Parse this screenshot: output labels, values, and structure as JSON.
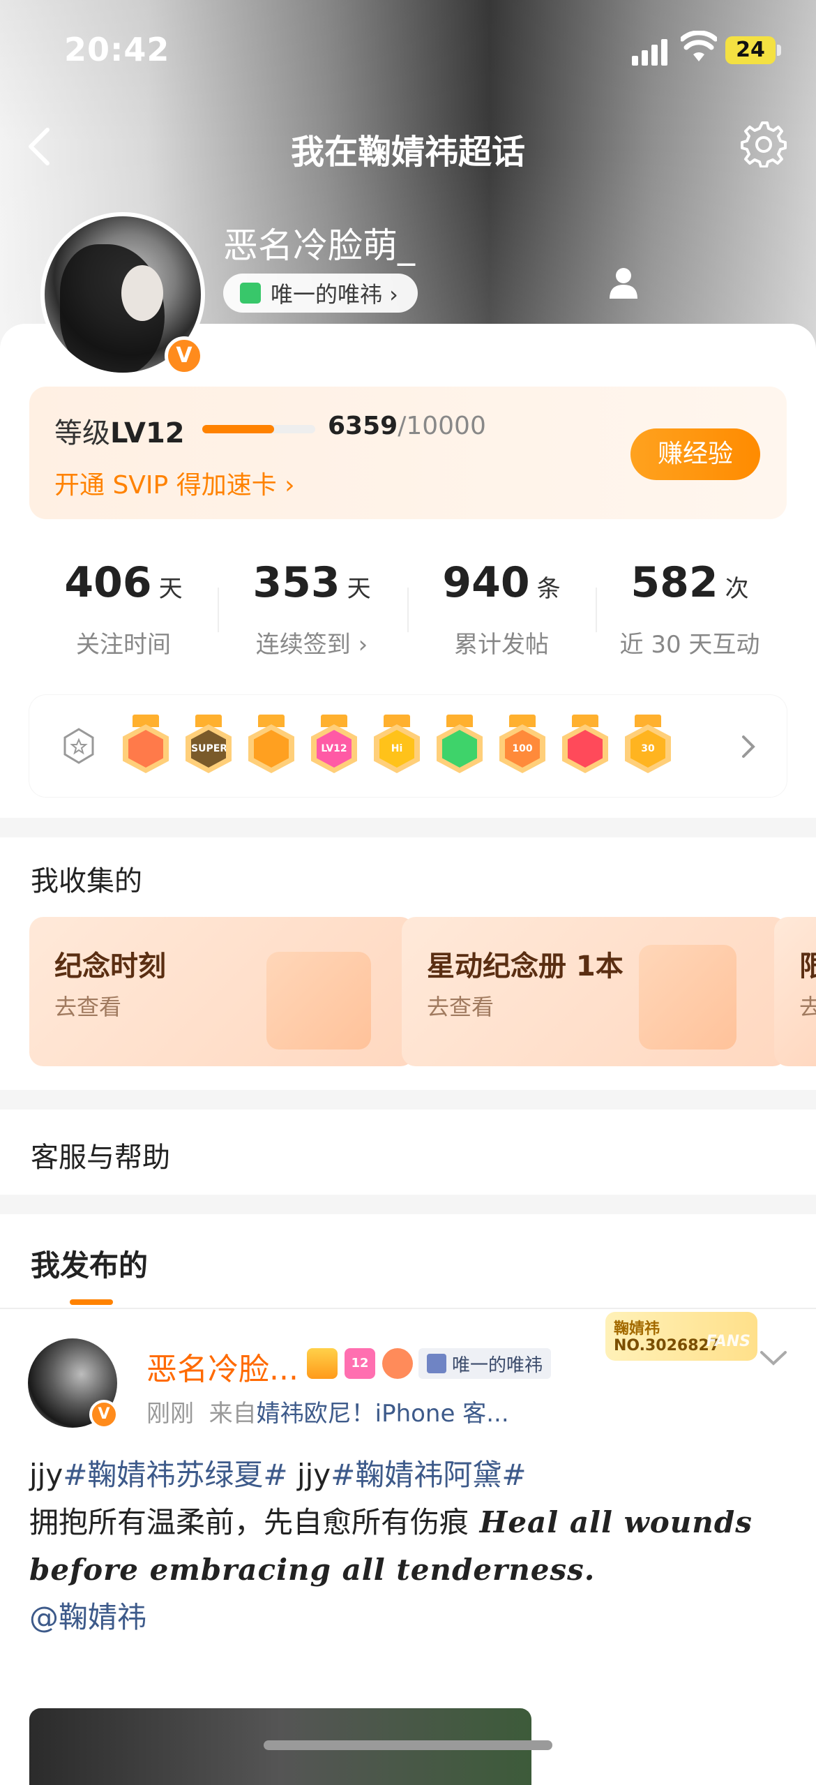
{
  "status_bar": {
    "time": "20:42",
    "battery": "24"
  },
  "nav": {
    "title": "我在鞠婧祎超话"
  },
  "profile": {
    "username": "恶名冷脸萌_",
    "fan_tag": "唯一的唯祎 ›",
    "verified_mark": "V"
  },
  "level": {
    "label_prefix": "等级",
    "level": "LV12",
    "exp_current": "6359",
    "exp_max": "/10000",
    "progress_fraction": 0.6359,
    "svip_link": "开通 SVIP 得加速卡 ›",
    "earn_button": "赚经验"
  },
  "stats": [
    {
      "value": "406",
      "unit": "天",
      "label": "关注时间"
    },
    {
      "value": "353",
      "unit": "天",
      "label": "连续签到 ›"
    },
    {
      "value": "940",
      "unit": "条",
      "label": "累计发帖"
    },
    {
      "value": "582",
      "unit": "次",
      "label": "近 30 天互动"
    }
  ],
  "badges": [
    {
      "icon": "cartoon-medal",
      "color": "#ff7a4a",
      "text": ""
    },
    {
      "icon": "super-medal",
      "color": "#7a5a2a",
      "text": "SUPER"
    },
    {
      "icon": "crown-medal",
      "color": "#ffa020",
      "text": ""
    },
    {
      "icon": "lv12-medal",
      "color": "#ff5aa5",
      "text": "LV12"
    },
    {
      "icon": "hi-medal",
      "color": "#ffc21a",
      "text": "Hi"
    },
    {
      "icon": "hand-medal",
      "color": "#3ed36a",
      "text": ""
    },
    {
      "icon": "100-days-medal",
      "color": "#ff8a3a",
      "text": "100"
    },
    {
      "icon": "trophy-medal",
      "color": "#ff4a5a",
      "text": ""
    },
    {
      "icon": "30-days-medal",
      "color": "#ffb420",
      "text": "30"
    }
  ],
  "collections": {
    "title": "我收集的",
    "cards": [
      {
        "title": "纪念时刻",
        "sub": "去查看"
      },
      {
        "title": "星动纪念册 1本",
        "sub": "去查看"
      },
      {
        "title": "限",
        "sub": "去"
      }
    ]
  },
  "help": {
    "title": "客服与帮助"
  },
  "posted": {
    "title": "我发布的"
  },
  "post": {
    "name": "恶名冷脸...",
    "fan_pill": "唯一的唯祎",
    "fan_card_line1": "鞠婧祎",
    "fan_card_line2": "NO.3026827",
    "fan_card_fans": "FANS",
    "meta_time": "刚刚",
    "meta_from": "来自",
    "meta_source": "婧祎欧尼！iPhone 客...",
    "line1_a": "jjy",
    "line1_tag1": "#鞠婧祎苏绿夏#",
    "line1_b": " jjy",
    "line1_tag2": "#鞠婧祎阿黛#",
    "line2_cn": "拥抱所有温柔前，先自愈所有伤痕",
    "line2_en": " Heal all wounds before embracing all tenderness.",
    "mention": "@鞠婧祎",
    "mini_badge_level": "12"
  },
  "colors": {
    "accent": "#ff8200",
    "link": "#3d5a8a",
    "username_orange": "#ff6a00"
  }
}
